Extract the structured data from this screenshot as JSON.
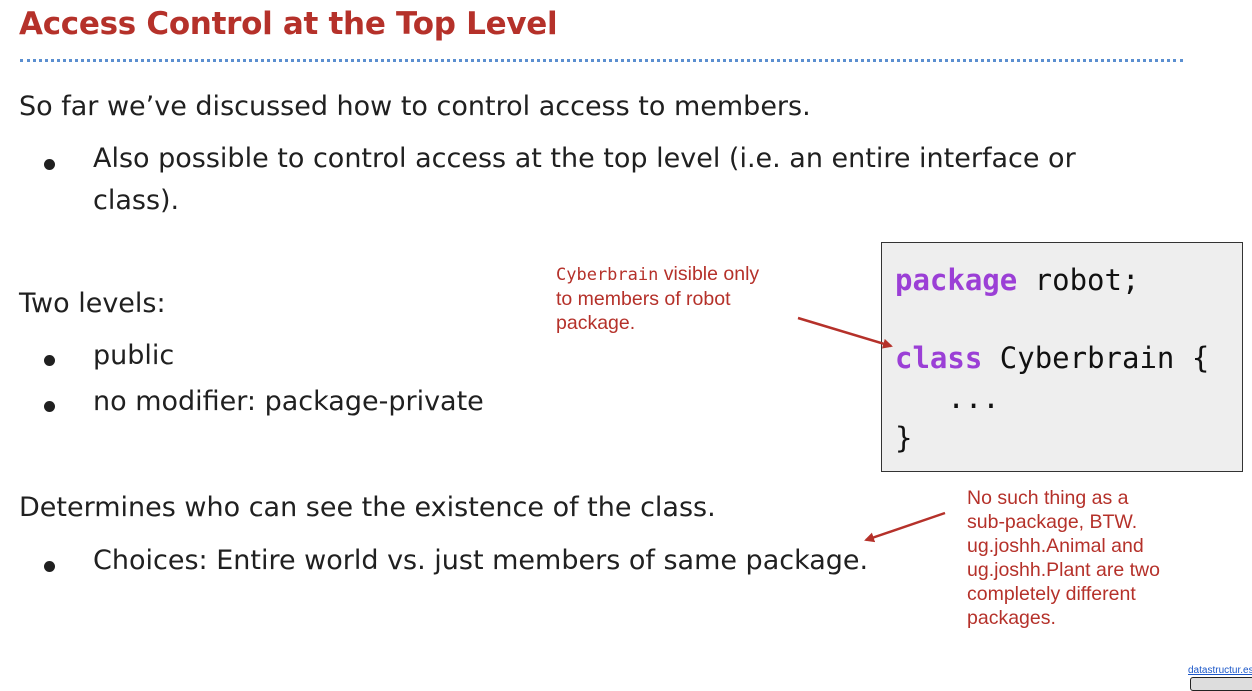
{
  "slide": {
    "title": "Access Control at the Top Level",
    "intro": "So far we’ve discussed how to control access to members.",
    "intro_bullet_line1": "Also possible to control access at the top level (i.e. an entire interface or",
    "intro_bullet_line2": "class).",
    "levels_heading": "Two levels:",
    "levels": [
      "public",
      "no modifier: package-private"
    ],
    "determines": "Determines who can see the existence of the class.",
    "choices": "Choices: Entire world vs. just members of same package."
  },
  "code": {
    "line1_keyword": "package",
    "line1_rest": " robot;",
    "line2_keyword": "class",
    "line2_rest": " Cyberbrain {",
    "line3": "   ...",
    "line4": "}"
  },
  "notes": {
    "cyberbrain_mono": "Cyberbrain",
    "cyberbrain_line1_rest": " visible only",
    "cyberbrain_line2": "to members of robot",
    "cyberbrain_line3": "package.",
    "subpackage_lines": [
      "No such thing as a",
      "sub-package, BTW.",
      "ug.joshh.Animal and",
      "ug.joshh.Plant are two",
      "completely different",
      "packages."
    ]
  },
  "footer": {
    "link": "datastructur.es"
  },
  "colors": {
    "title": "#b5312a",
    "note": "#b5312a",
    "keyword": "#9b3fd6",
    "rule": "#5b8fd0"
  }
}
